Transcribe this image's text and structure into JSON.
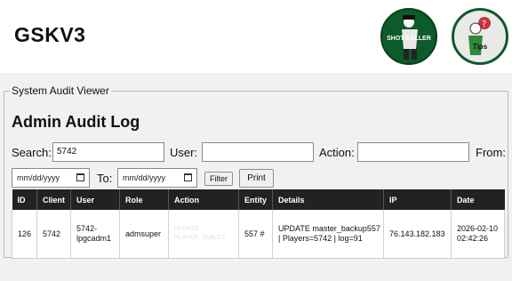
{
  "header": {
    "app_title": "GSKV3",
    "logos": [
      {
        "name": "shot-caller-logo",
        "caption": "SHOT CALLER"
      },
      {
        "name": "tips-logo",
        "caption": "Tips"
      }
    ]
  },
  "viewer": {
    "legend": "System Audit Viewer",
    "title": "Admin Audit Log",
    "filters": {
      "search_label": "Search:",
      "search_value": "5742",
      "user_label": "User:",
      "user_value": "",
      "action_label": "Action:",
      "action_value": "",
      "from_label": "From:",
      "from_placeholder": "mm/dd/yyyy",
      "to_label": "To:",
      "to_placeholder": "mm/dd/yyyy",
      "filter_button": "Filter",
      "print_button": "Print"
    },
    "table": {
      "columns": [
        "ID",
        "Client",
        "User",
        "Role",
        "Action",
        "Entity",
        "Details",
        "IP",
        "Date"
      ],
      "rows": [
        {
          "id": "126",
          "client": "5742",
          "user": "5742-lpgcadm1",
          "role": "admsuper",
          "action": "UPDATE PLAYER_TABLES",
          "entity": "557 #",
          "details": "UPDATE master_backup557 | Players=5742 | log=91",
          "ip": "76.143.182.183",
          "date": "2026-02-10 02:42:26"
        }
      ]
    }
  }
}
